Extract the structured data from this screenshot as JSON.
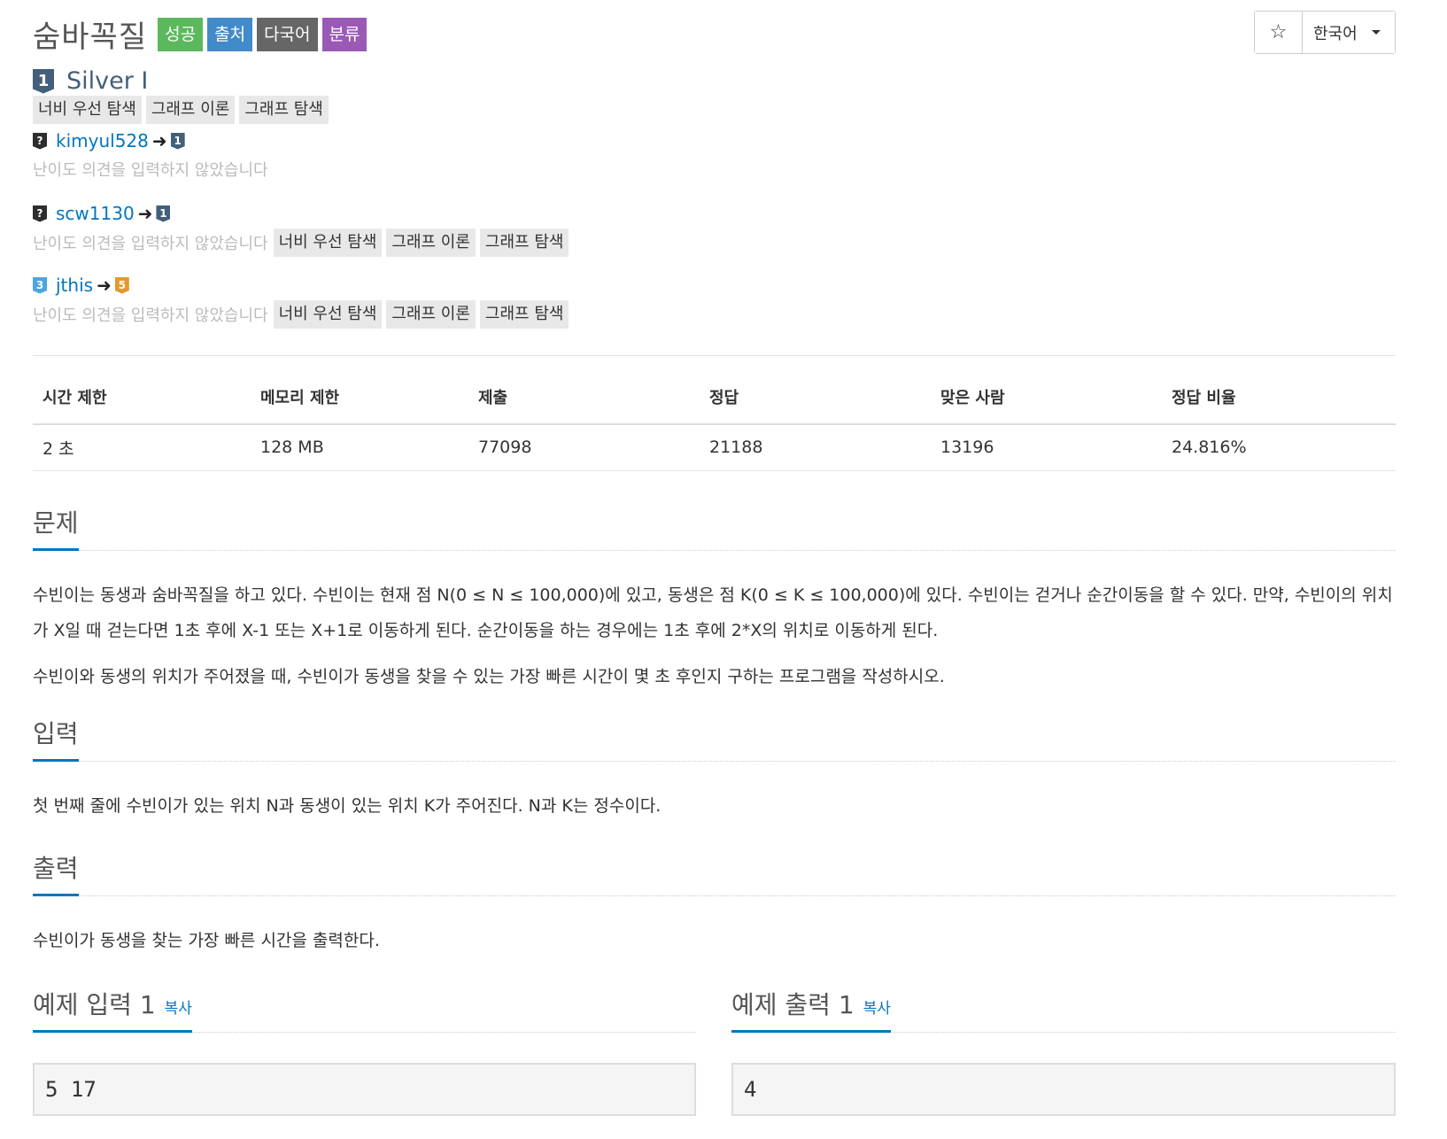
{
  "problem": {
    "title": "숨바꼭질",
    "labels": [
      {
        "text": "성공",
        "color": "#5cb85c"
      },
      {
        "text": "출처",
        "color": "#428bca"
      },
      {
        "text": "다국어",
        "color": "#666666"
      },
      {
        "text": "분류",
        "color": "#9b59b6"
      }
    ]
  },
  "top_controls": {
    "star_icon": "star-outline-icon",
    "language": "한국어"
  },
  "tier": {
    "badge": "1",
    "name": "Silver I",
    "color": "#435f7a"
  },
  "tags": [
    "너비 우선 탐색",
    "그래프 이론",
    "그래프 탐색"
  ],
  "opinions": [
    {
      "user": "kimyul528",
      "from_badge": "?",
      "to_badge": "1",
      "text": "난이도 의견을 입력하지 않았습니다",
      "tags": []
    },
    {
      "user": "scw1130",
      "from_badge": "?",
      "to_badge": "1",
      "text": "난이도 의견을 입력하지 않았습니다",
      "tags": [
        "너비 우선 탐색",
        "그래프 이론",
        "그래프 탐색"
      ]
    },
    {
      "user": "jthis",
      "from_badge": "3",
      "to_badge": "5",
      "text": "난이도 의견을 입력하지 않았습니다",
      "tags": [
        "너비 우선 탐색",
        "그래프 이론",
        "그래프 탐색"
      ]
    }
  ],
  "stats": {
    "headers": [
      "시간 제한",
      "메모리 제한",
      "제출",
      "정답",
      "맞은 사람",
      "정답 비율"
    ],
    "values": [
      "2 초",
      "128 MB",
      "77098",
      "21188",
      "13196",
      "24.816%"
    ]
  },
  "sections": {
    "problem_title": "문제",
    "problem_p1": "수빈이는 동생과 숨바꼭질을 하고 있다. 수빈이는 현재 점 N(0 ≤ N ≤ 100,000)에 있고, 동생은 점 K(0 ≤ K ≤ 100,000)에 있다. 수빈이는 걷거나 순간이동을 할 수 있다. 만약, 수빈이의 위치가 X일 때 걷는다면 1초 후에 X-1 또는 X+1로 이동하게 된다. 순간이동을 하는 경우에는 1초 후에 2*X의 위치로 이동하게 된다.",
    "problem_p2": "수빈이와 동생의 위치가 주어졌을 때, 수빈이가 동생을 찾을 수 있는 가장 빠른 시간이 몇 초 후인지 구하는 프로그램을 작성하시오.",
    "input_title": "입력",
    "input_text": "첫 번째 줄에 수빈이가 있는 위치 N과 동생이 있는 위치 K가 주어진다. N과 K는 정수이다.",
    "output_title": "출력",
    "output_text": "수빈이가 동생을 찾는 가장 빠른 시간을 출력한다."
  },
  "samples": {
    "input_title": "예제 입력 1",
    "output_title": "예제 출력 1",
    "copy_label": "복사",
    "input_value": "5 17",
    "output_value": "4"
  }
}
